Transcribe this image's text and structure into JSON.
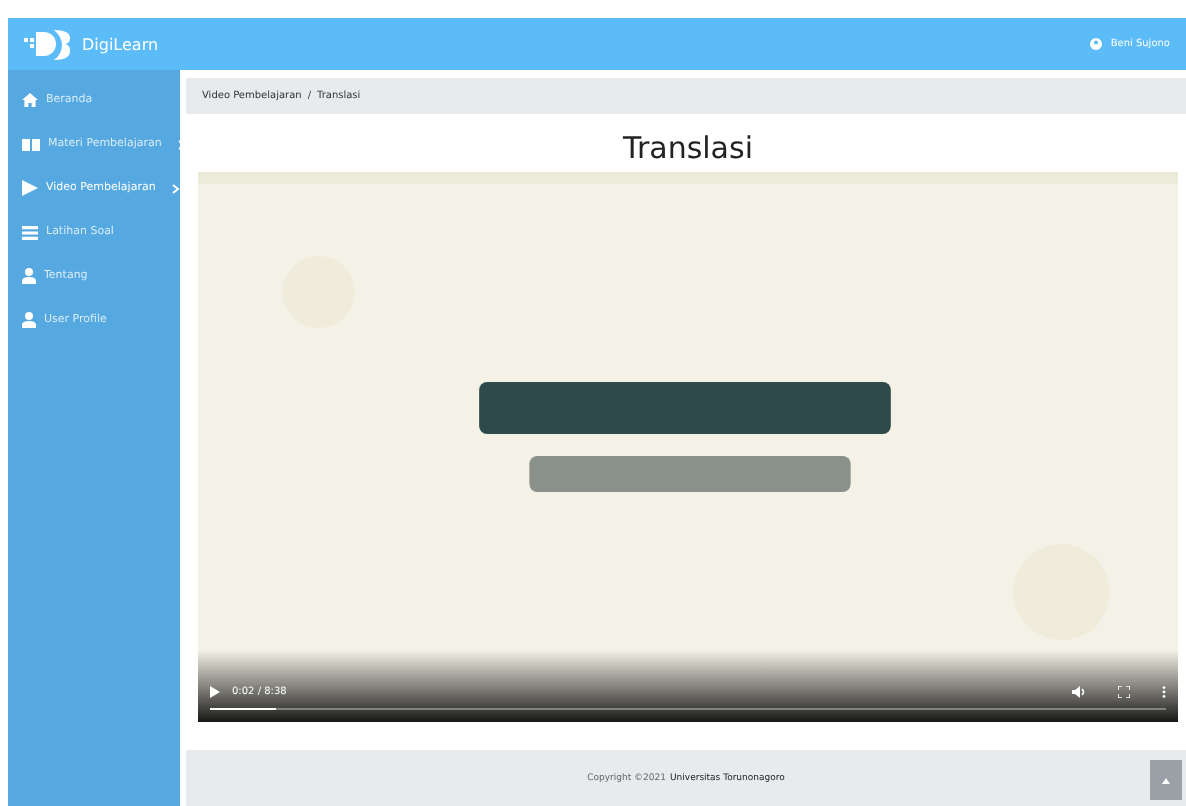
{
  "brand": {
    "name": "DigiLearn"
  },
  "user": {
    "name": "Beni Sujono"
  },
  "sidebar": {
    "items": [
      {
        "label": "Beranda",
        "kind": "home",
        "selected": false,
        "submenu": false
      },
      {
        "label": "Materi Pembelajaran",
        "kind": "book",
        "selected": false,
        "submenu": true
      },
      {
        "label": "Video Pembelajaran",
        "kind": "play",
        "selected": true,
        "submenu": true
      },
      {
        "label": "Latihan Soal",
        "kind": "list",
        "selected": false,
        "submenu": false
      },
      {
        "label": "Tentang",
        "kind": "user",
        "selected": false,
        "submenu": false
      },
      {
        "label": "User Profile",
        "kind": "user",
        "selected": false,
        "submenu": false
      }
    ]
  },
  "breadcrumb": [
    "Video Pembelajaran",
    "/",
    "Translasi"
  ],
  "page": {
    "title": "Translasi"
  },
  "video": {
    "time": "0:02 / 8:38",
    "level": 0.07
  },
  "footer": {
    "copyright": "Copyright ©2021",
    "owner": "Universitas Torunonagoro"
  }
}
